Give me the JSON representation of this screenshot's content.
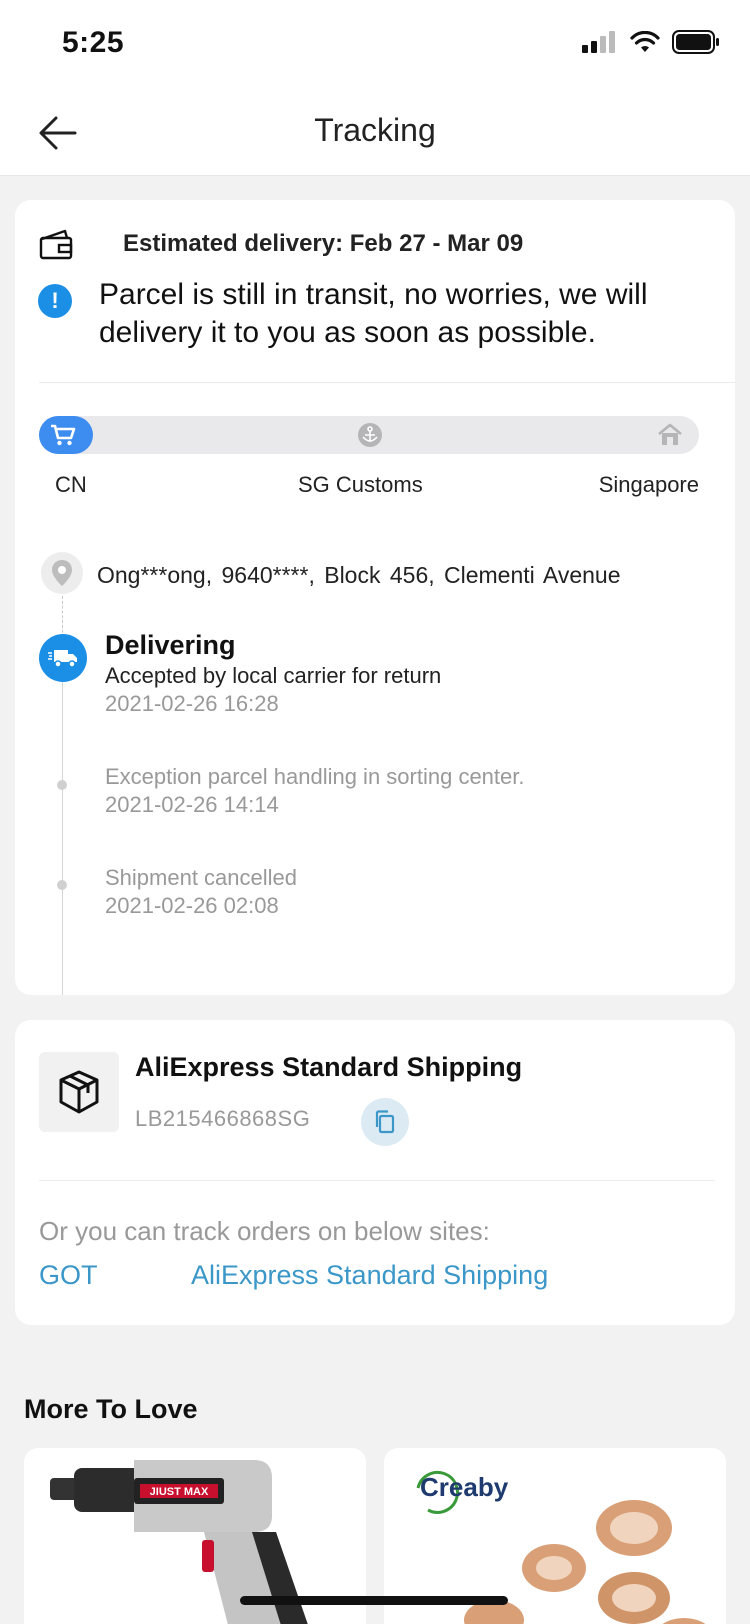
{
  "status_bar": {
    "time": "5:25"
  },
  "nav": {
    "title": "Tracking"
  },
  "delivery": {
    "estimated": "Estimated delivery: Feb 27 - Mar 09",
    "notice": "Parcel is still in transit, no worries, we will delivery it to you as soon as possible.",
    "progress": 0.05,
    "stages": [
      "CN",
      "SG Customs",
      "Singapore"
    ]
  },
  "address": {
    "text": "Ong***ong,  9640****,  Block 456, Clementi Avenue"
  },
  "events": [
    {
      "title": "Delivering",
      "description": "Accepted by local carrier for return",
      "time": "2021-02-26 16:28"
    },
    {
      "description": "Exception parcel handling in sorting center.",
      "time": "2021-02-26 14:14"
    },
    {
      "description": "Shipment cancelled",
      "time": "2021-02-26 02:08"
    }
  ],
  "shipping": {
    "method": "AliExpress Standard Shipping",
    "tracking_number": "LB215466868SG",
    "other_sites_label": "Or you can track orders on below sites:",
    "sites": [
      "GOT",
      "AliExpress Standard Shipping"
    ]
  },
  "more_to_love": {
    "title": "More To Love",
    "products": [
      {
        "brand_label": "JIUST MAX"
      },
      {
        "brand_label": "Creaby"
      }
    ]
  },
  "colors": {
    "accent": "#1b8fe6",
    "link": "#3a97c8",
    "progress": "#3d8cf0"
  }
}
